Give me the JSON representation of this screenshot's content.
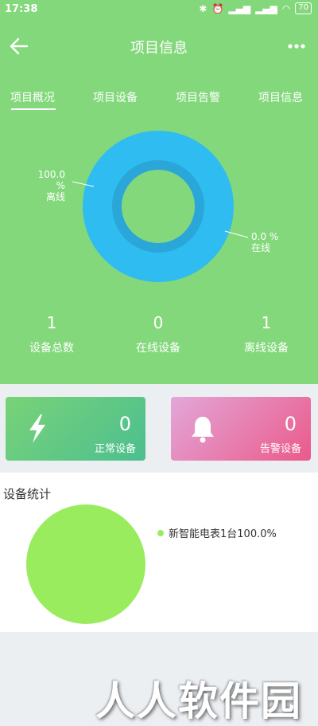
{
  "status_bar": {
    "time": "17:38",
    "battery": "70"
  },
  "nav": {
    "title": "项目信息"
  },
  "tabs": [
    {
      "label": "项目概况",
      "active": true
    },
    {
      "label": "项目设备",
      "active": false
    },
    {
      "label": "项目告警",
      "active": false
    },
    {
      "label": "项目信息",
      "active": false
    }
  ],
  "donut": {
    "offline_pct": "100.0 %",
    "offline_label": "离线",
    "online_pct": "0.0 %",
    "online_label": "在线",
    "offline_share": 1.0,
    "online_share": 0.0,
    "color": "#2fbcf0"
  },
  "stats": {
    "total": {
      "value": "1",
      "label": "设备总数"
    },
    "online": {
      "value": "0",
      "label": "在线设备"
    },
    "offline": {
      "value": "1",
      "label": "离线设备"
    }
  },
  "cards": {
    "normal": {
      "value": "0",
      "label": "正常设备",
      "icon": "lightning-icon"
    },
    "alarm": {
      "value": "0",
      "label": "告警设备",
      "icon": "bell-icon"
    }
  },
  "device_stats": {
    "title": "设备统计",
    "legend": "新智能电表1台100.0%",
    "color": "#98ec5e"
  },
  "watermark": "人人软件园",
  "colors": {
    "header": "#84d87c",
    "donut": "#2fbcf0"
  }
}
